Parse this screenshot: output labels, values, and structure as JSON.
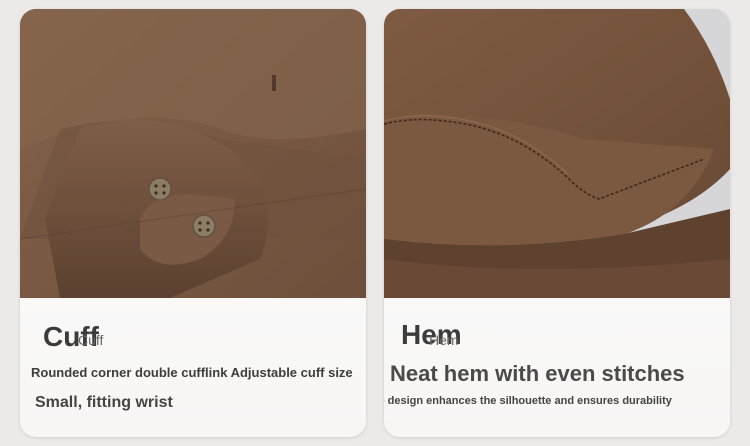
{
  "cards": [
    {
      "title": "Cuff",
      "title_ghost": "Cuff",
      "line1": "Rounded corner double cufflink Adjustable cuff size",
      "line2": "Small, fitting wrist"
    },
    {
      "title": "Hem",
      "title_ghost": "Hem",
      "line1": "Neat hem with even stitches",
      "line2": "The design enhances the silhouette and ensures durability"
    }
  ],
  "colors": {
    "fabric": "#7c5b44",
    "fabric_dark": "#5e4230",
    "fabric_light": "#8e6a52",
    "button": "#8a7a66"
  }
}
